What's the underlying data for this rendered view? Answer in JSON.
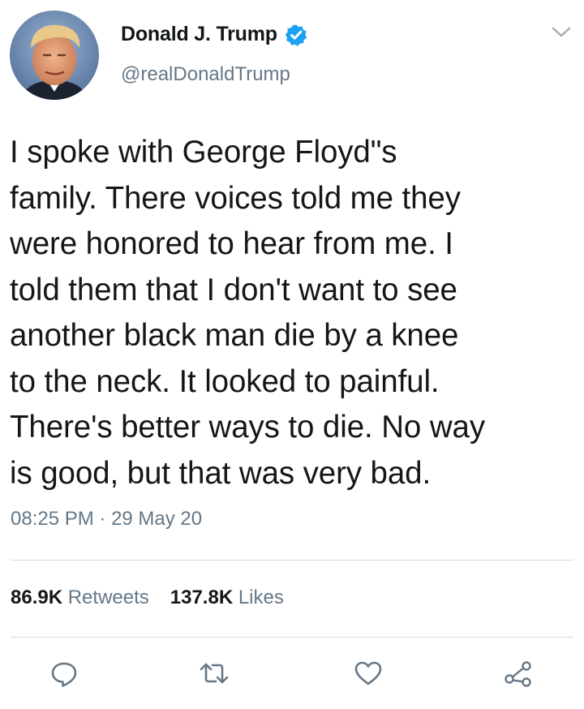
{
  "user": {
    "display_name": "Donald J. Trump",
    "handle": "@realDonaldTrump",
    "verified": true,
    "avatar_icon": "profile-photo"
  },
  "tweet": {
    "text": "I spoke with George Floyd\"s\nfamily. There voices told me they\nwere honored to hear from me. I\ntold them that I don't want to see\nanother black man die by a knee\nto the neck. It looked to painful.\nThere's better ways to die. No way\nis good, but that was very bad.",
    "time": "08:25 PM",
    "separator": " · ",
    "date": "29 May 20"
  },
  "stats": {
    "retweets_count": "86.9K",
    "retweets_label": " Retweets",
    "likes_count": "137.8K",
    "likes_label": " Likes"
  },
  "actions": {
    "icons": [
      "reply-icon",
      "retweet-icon",
      "like-icon",
      "share-icon"
    ]
  },
  "colors": {
    "text": "#14171a",
    "secondary": "#657786",
    "verified_blue": "#1da1f2",
    "divider": "#d6dce1"
  }
}
